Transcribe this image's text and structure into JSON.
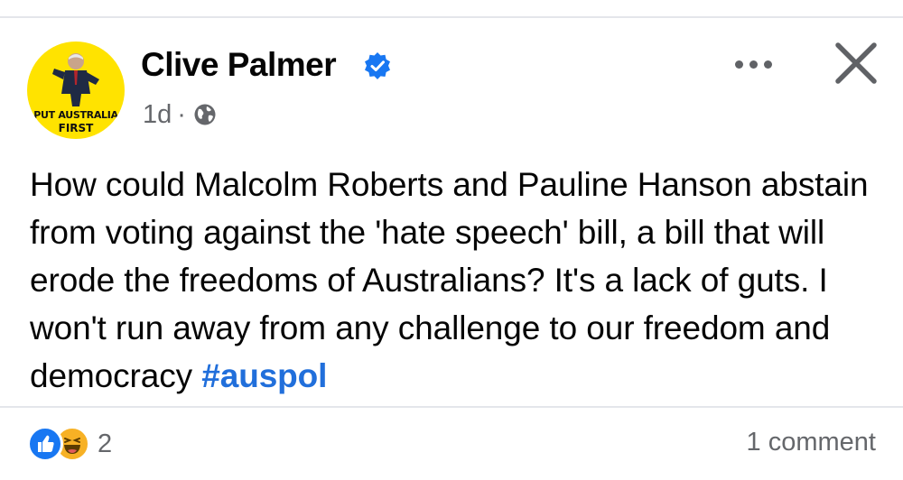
{
  "post": {
    "author": "Clive Palmer",
    "avatar_text_line1": "PUT AUSTRALIA",
    "avatar_text_line2": "FIRST",
    "time": "1d",
    "separator": "·",
    "audience_icon": "globe-icon",
    "text": "How could Malcolm Roberts and Pauline Hanson abstain from voting against the 'hate speech' bill, a bill that will erode the freedoms of Australians? It's a lack of guts. I won't run away from any challenge to our freedom and democracy ",
    "hashtag": "#auspol"
  },
  "footer": {
    "reaction_icons": [
      "like-icon",
      "haha-icon"
    ],
    "reaction_count": "2",
    "comments_label": "1 comment"
  },
  "colors": {
    "verified": "#1877f2",
    "hashtag": "#216fdb",
    "avatar_bg": "#ffe300",
    "secondary_text": "#65676b"
  }
}
